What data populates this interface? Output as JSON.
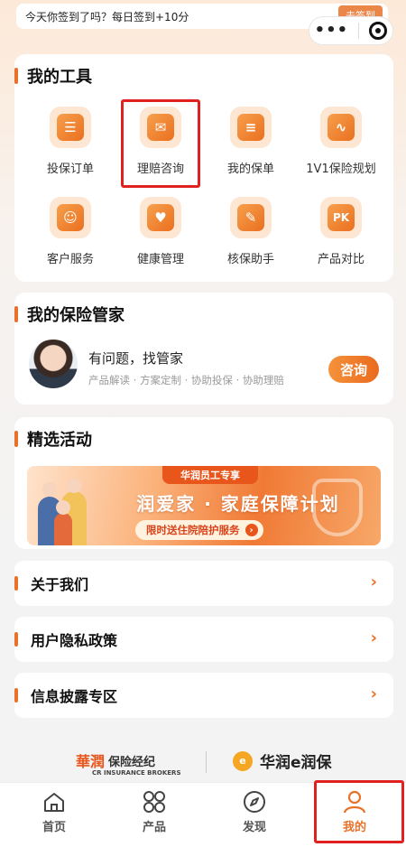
{
  "signin": {
    "text": "今天你签到了吗？每日签到+10分",
    "action": "去签到"
  },
  "tools": {
    "title": "我的工具",
    "items": [
      {
        "label": "投保订单",
        "icon": "order-icon",
        "glyph": "☰"
      },
      {
        "label": "理赔咨询",
        "icon": "claim-shield-icon",
        "glyph": "✉"
      },
      {
        "label": "我的保单",
        "icon": "policy-icon",
        "glyph": "≡"
      },
      {
        "label": "1V1保险规划",
        "icon": "planning-chart-icon",
        "glyph": "∿"
      },
      {
        "label": "客户服务",
        "icon": "customer-service-icon",
        "glyph": "☺"
      },
      {
        "label": "健康管理",
        "icon": "health-icon",
        "glyph": "♥"
      },
      {
        "label": "核保助手",
        "icon": "underwriting-icon",
        "glyph": "✎"
      },
      {
        "label": "产品对比",
        "icon": "pk-compare-icon",
        "glyph": "PK"
      }
    ]
  },
  "keeper": {
    "title": "我的保险管家",
    "question": "有问题，找管家",
    "services": "产品解读 · 方案定制 · 协助投保 · 协助理赔",
    "button": "咨询"
  },
  "activity": {
    "title": "精选活动",
    "banner_tag": "华润员工专享",
    "banner_headline": "润爱家 · 家庭保障计划",
    "banner_pill": "限时送住院陪护服务"
  },
  "rows": [
    {
      "label": "关于我们"
    },
    {
      "label": "用户隐私政策"
    },
    {
      "label": "信息披露专区"
    }
  ],
  "brands": {
    "left_logo": "華潤",
    "left_name": "保险经纪",
    "left_en": "CR INSURANCE BROKERS",
    "right_logo": "e",
    "right_name": "华润e润保"
  },
  "tabbar": [
    {
      "label": "首页",
      "icon": "home-icon"
    },
    {
      "label": "产品",
      "icon": "product-grid-icon"
    },
    {
      "label": "发现",
      "icon": "compass-icon"
    },
    {
      "label": "我的",
      "icon": "user-icon",
      "active": true
    }
  ],
  "colors": {
    "accent": "#e8722a",
    "highlight": "#e0211f"
  }
}
